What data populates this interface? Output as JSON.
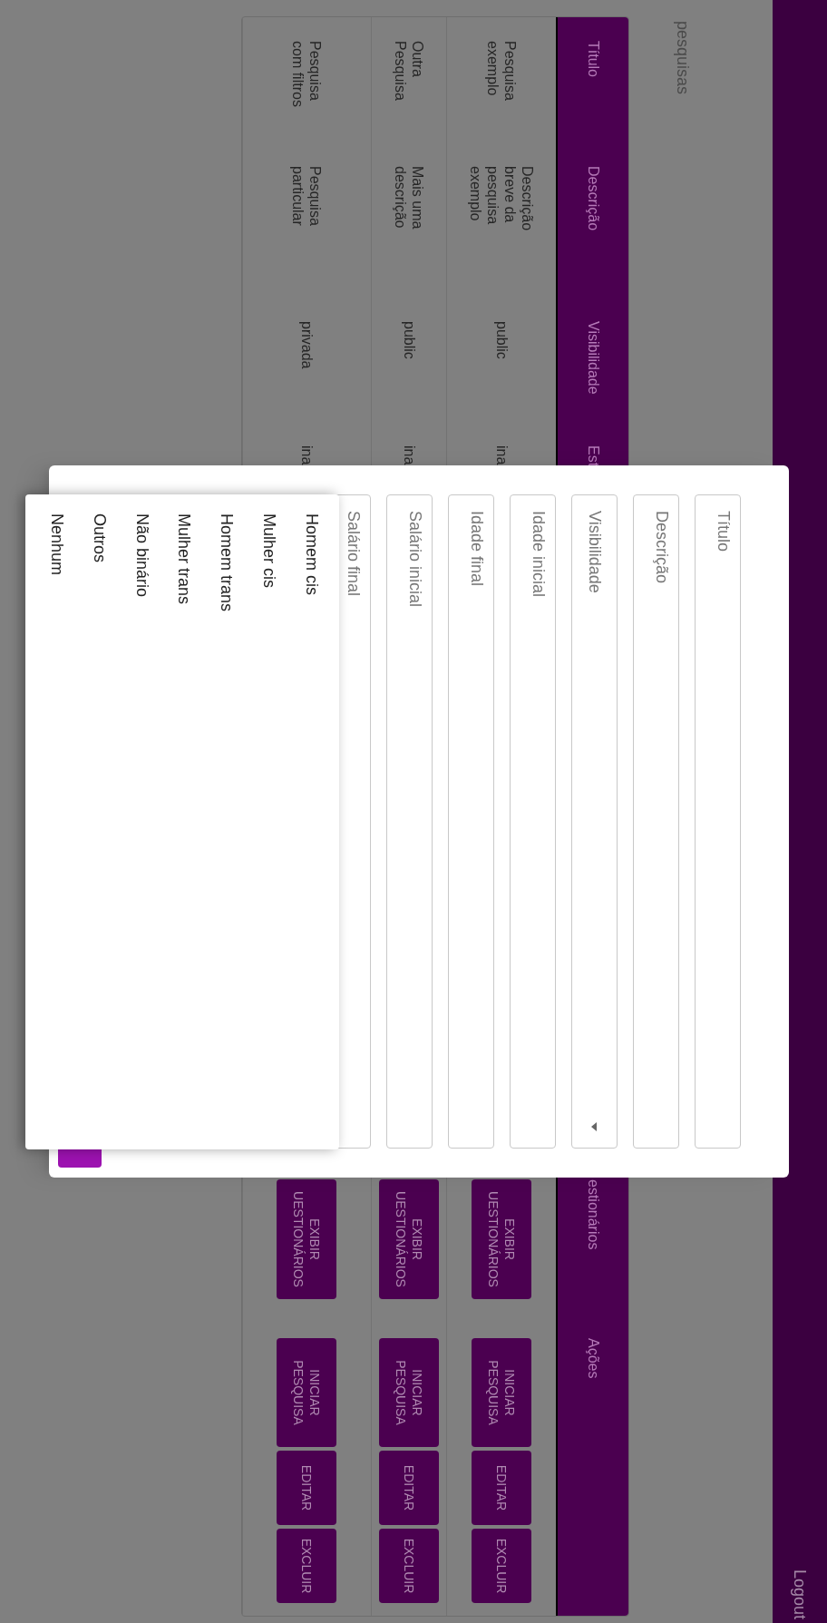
{
  "top_bar": {
    "logout": "Logout"
  },
  "page_title": "pesquisas",
  "table": {
    "columns": [
      "Título",
      "Descrição",
      "Visibilidade",
      "Est",
      "estionários",
      "Ações"
    ],
    "rows": [
      {
        "title": "Pesquisa exemplo",
        "description": "Descrição breve da pesquisa exemplo",
        "visibility": "public",
        "state": "ina",
        "questionnaires_button": "EXIBIR UESTIONÁRIOS",
        "actions": [
          "INICIAR PESQUISA",
          "EDITAR",
          "EXCLUIR"
        ]
      },
      {
        "title": "Outra Pesquisa",
        "description": "Mais uma descrição",
        "visibility": "public",
        "state": "ina",
        "questionnaires_button": "EXIBIR UESTIONÁRIOS",
        "actions": [
          "INICIAR PESQUISA",
          "EDITAR",
          "EXCLUIR"
        ]
      },
      {
        "title": "Pesquisa com filtros",
        "description": "Pesquisa particular",
        "visibility": "privada",
        "state": "ina",
        "questionnaires_button": "EXIBIR UESTIONÁRIOS",
        "actions": [
          "INICIAR PESQUISA",
          "EDITAR",
          "EXCLUIR"
        ]
      }
    ]
  },
  "modal": {
    "fields": [
      {
        "kind": "text",
        "placeholder": "Título"
      },
      {
        "kind": "text",
        "placeholder": "Descrição"
      },
      {
        "kind": "select",
        "placeholder": "Visibilidade"
      },
      {
        "kind": "text",
        "placeholder": "Idade inicial"
      },
      {
        "kind": "text",
        "placeholder": "Idade final"
      },
      {
        "kind": "text",
        "placeholder": "Salário inicial"
      },
      {
        "kind": "text",
        "placeholder": "Salário final"
      }
    ],
    "menu_options": [
      "Homem cis",
      "Mulher cis",
      "Homem trans",
      "Mulher trans",
      "Não binário",
      "Outros",
      "Nenhum"
    ]
  }
}
